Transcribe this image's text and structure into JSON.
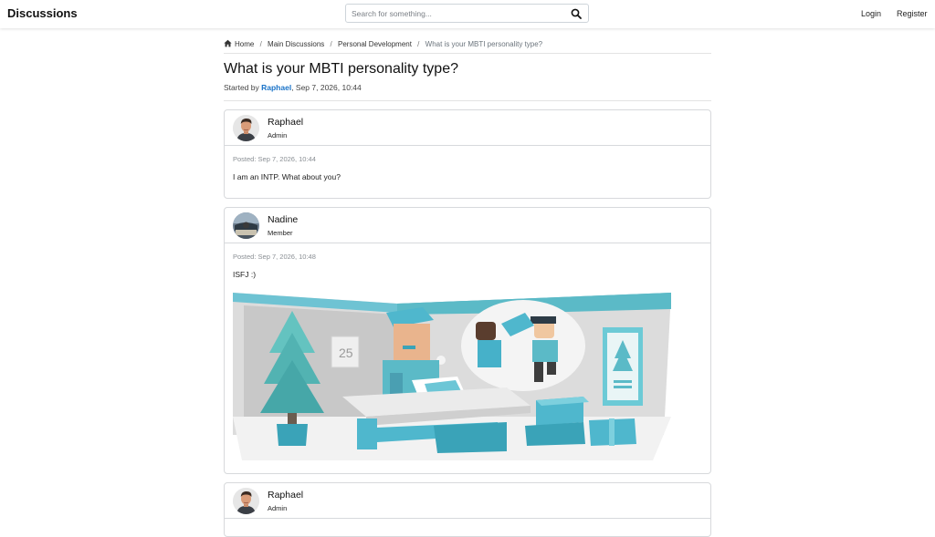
{
  "header": {
    "brand": "Discussions",
    "search_placeholder": "Search for something...",
    "login": "Login",
    "register": "Register"
  },
  "breadcrumb": {
    "items": [
      "Home",
      "Main Discussions",
      "Personal Development",
      "What is your MBTI personality type?"
    ],
    "separator": "/"
  },
  "thread": {
    "title": "What is your MBTI personality type?",
    "started_by_prefix": "Started by ",
    "author": "Raphael",
    "date_suffix": ", Sep 7, 2026, 10:44"
  },
  "posts": [
    {
      "username": "Raphael",
      "role": "Admin",
      "posted": "Posted: Sep 7, 2026, 10:44",
      "text": "I am an INTP. What about you?"
    },
    {
      "username": "Nadine",
      "role": "Member",
      "posted": "Posted: Sep 7, 2026, 10:48",
      "text": "ISFJ :)",
      "image_caption_number": "25"
    },
    {
      "username": "Raphael",
      "role": "Admin"
    }
  ],
  "colors": {
    "link": "#1a73c8",
    "teal": "#5bbac7",
    "border": "#d7d9dc"
  }
}
